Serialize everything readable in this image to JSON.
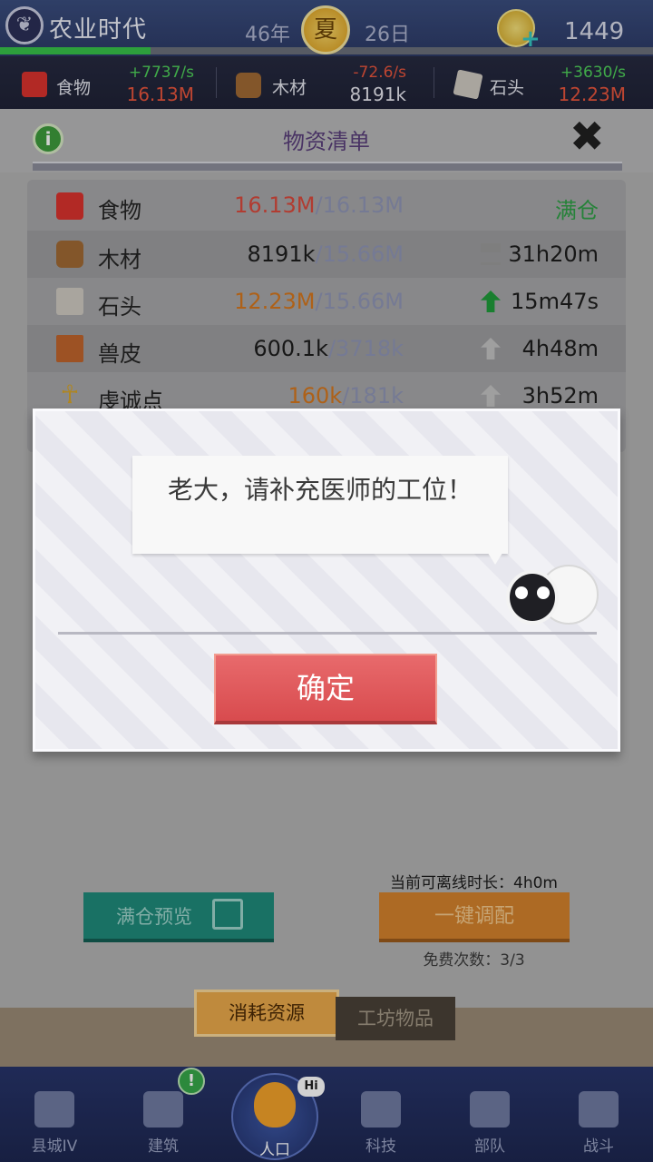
{
  "top": {
    "era_title": "农业时代",
    "year": "46年",
    "season": "夏",
    "day": "26日",
    "gems": "1449",
    "era_progress": 0.23
  },
  "resources": [
    {
      "name": "食物",
      "rate": "+7737/s",
      "amount": "16.13M",
      "rate_color": "#4fd05a",
      "amount_color": "#e8553c"
    },
    {
      "name": "木材",
      "rate": "-72.6/s",
      "amount": "8191k",
      "rate_color": "#e8553c",
      "amount_color": "#e6e6ee"
    },
    {
      "name": "石头",
      "rate": "+3630/s",
      "amount": "12.23M",
      "rate_color": "#4fd05a",
      "amount_color": "#e8553c"
    }
  ],
  "panel": {
    "title": "物资清单",
    "rows": [
      {
        "name": "食物",
        "current": "16.13M",
        "max": "/16.13M",
        "time": "满仓",
        "current_color": "#d84a3c",
        "time_color": "#2f9f46"
      },
      {
        "name": "木材",
        "current": "8191k",
        "max": "/15.66M",
        "time": "31h20m",
        "current_color": "#1d1d1d",
        "time_color": "#1d1d1d"
      },
      {
        "name": "石头",
        "current": "12.23M",
        "max": "/15.66M",
        "time": "15m47s",
        "current_color": "#d5771e",
        "time_color": "#1d1d1d"
      },
      {
        "name": "兽皮",
        "current": "600.1k",
        "max": "/3718k",
        "time": "4h48m",
        "current_color": "#1d1d1d",
        "time_color": "#1d1d1d"
      },
      {
        "name": "虔诚点",
        "current": "160k",
        "max": "/181k",
        "time": "3h52m",
        "current_color": "#d5771e",
        "time_color": "#1d1d1d"
      }
    ],
    "offline_label": "当前可离线时长：4h0m",
    "full_preview": "满仓预览",
    "one_key": "一键调配",
    "free_count": "免费次数：3/3",
    "tab_consume": "消耗资源",
    "tab_workshop": "工坊物品"
  },
  "dialog": {
    "message": "老大，请补充医师的工位！",
    "confirm": "确定"
  },
  "nav": [
    {
      "label": "县城IV"
    },
    {
      "label": "建筑"
    },
    {
      "label": "人口"
    },
    {
      "label": "科技"
    },
    {
      "label": "部队"
    },
    {
      "label": "战斗"
    }
  ],
  "nav_badge": "!",
  "hi_bubble": "Hi",
  "icons": {
    "info": "i",
    "close": "✖"
  }
}
